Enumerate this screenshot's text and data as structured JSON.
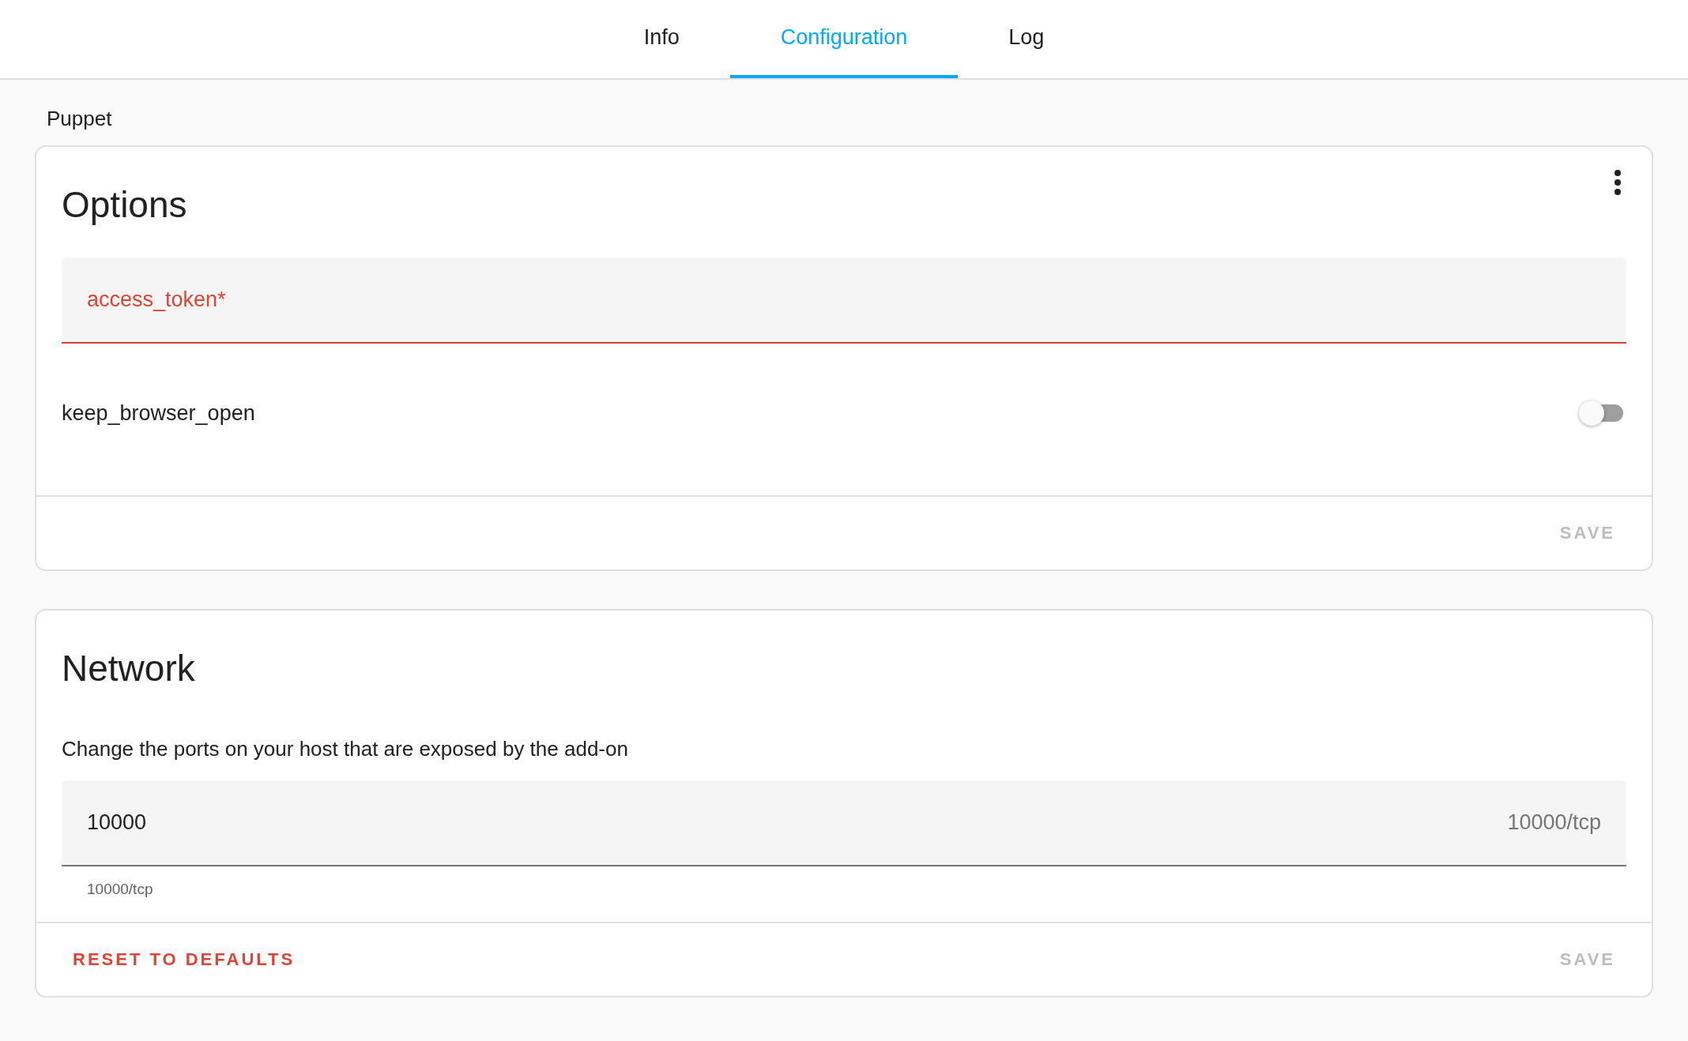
{
  "tabs": [
    {
      "label": "Info",
      "selected": false
    },
    {
      "label": "Configuration",
      "selected": true
    },
    {
      "label": "Log",
      "selected": false
    }
  ],
  "breadcrumb": "Puppet",
  "options_card": {
    "title": "Options",
    "fields": [
      {
        "kind": "text",
        "label": "access_token*",
        "invalid": true
      },
      {
        "kind": "toggle",
        "label": "keep_browser_open",
        "on": false
      }
    ],
    "save": {
      "label": "SAVE",
      "disabled": true
    }
  },
  "network_card": {
    "title": "Network",
    "description": "Change the ports on your host that are exposed by the add-on",
    "port_field": {
      "value": "10000",
      "suffix": "10000/tcp",
      "helper": "10000/tcp"
    },
    "reset": {
      "label": "RESET TO DEFAULTS"
    },
    "save": {
      "label": "SAVE",
      "disabled": true
    }
  }
}
